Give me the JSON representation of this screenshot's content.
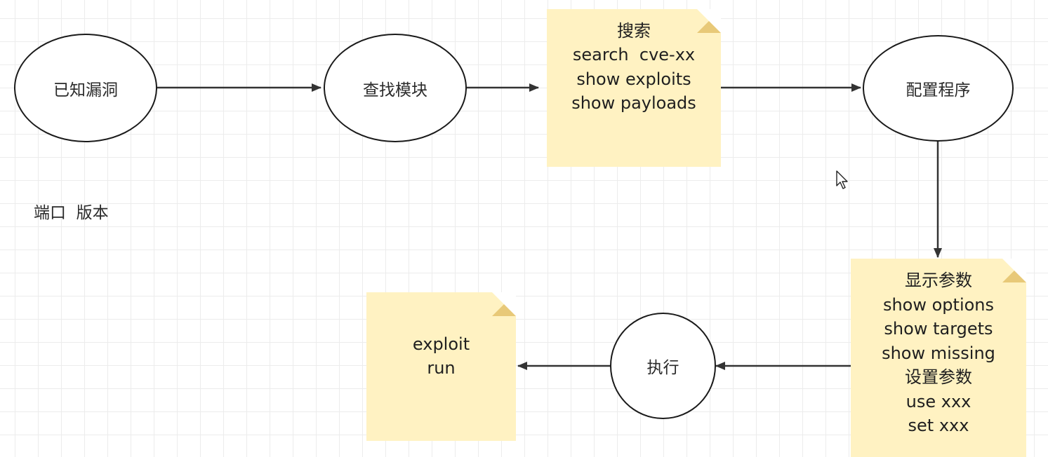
{
  "diagram": {
    "nodes": {
      "known_vuln": "已知漏洞",
      "find_module": "查找模块",
      "configure": "配置程序",
      "execute": "执行"
    },
    "search_note": [
      "搜索",
      "search  cve-xx",
      "show exploits",
      "show payloads"
    ],
    "options_note": [
      "显示参数",
      "show options",
      "show targets",
      "show missing",
      "设置参数",
      "use xxx",
      "set xxx"
    ],
    "exploit_note": [
      "exploit",
      "run"
    ],
    "free_label": "端口  版本"
  },
  "colors": {
    "note_fill": "#fff2c2",
    "note_fold": "#e8c978",
    "edge": "#333333",
    "grid": "#ececec"
  },
  "icons": {
    "cursor": "mouse-pointer-icon"
  }
}
